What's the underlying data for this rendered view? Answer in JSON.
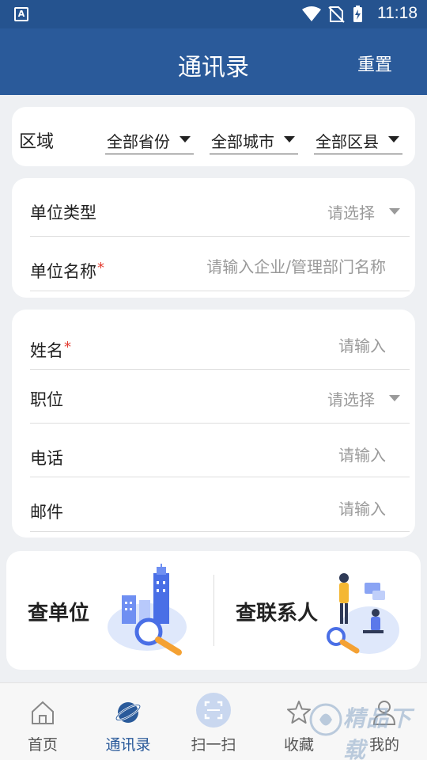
{
  "status_bar": {
    "time": "11:18",
    "app_badge": "A"
  },
  "header": {
    "title": "通讯录",
    "reset_label": "重置"
  },
  "region": {
    "label": "区域",
    "province": "全部省份",
    "city": "全部城市",
    "county": "全部区县"
  },
  "org": {
    "type_label": "单位类型",
    "type_placeholder": "请选择",
    "name_label": "单位名称",
    "name_required": "*",
    "name_placeholder": "请输入企业/管理部门名称"
  },
  "person": {
    "name_label": "姓名",
    "name_required": "*",
    "name_placeholder": "请输入",
    "position_label": "职位",
    "position_placeholder": "请选择",
    "phone_label": "电话",
    "phone_placeholder": "请输入",
    "email_label": "邮件",
    "email_placeholder": "请输入"
  },
  "search": {
    "org_label": "查单位",
    "contact_label": "查联系人"
  },
  "tabs": [
    {
      "label": "首页",
      "icon": "home-icon",
      "active": false
    },
    {
      "label": "通讯录",
      "icon": "planet-icon",
      "active": true
    },
    {
      "label": "扫一扫",
      "icon": "scan-icon",
      "active": false
    },
    {
      "label": "收藏",
      "icon": "star-icon",
      "active": false
    },
    {
      "label": "我的",
      "icon": "person-icon",
      "active": false
    }
  ],
  "watermark": {
    "text": "精品下载"
  },
  "colors": {
    "primary": "#2a5a9a",
    "status_bar": "#25538f",
    "required": "#e23a2f",
    "placeholder": "#9a9a9a"
  }
}
